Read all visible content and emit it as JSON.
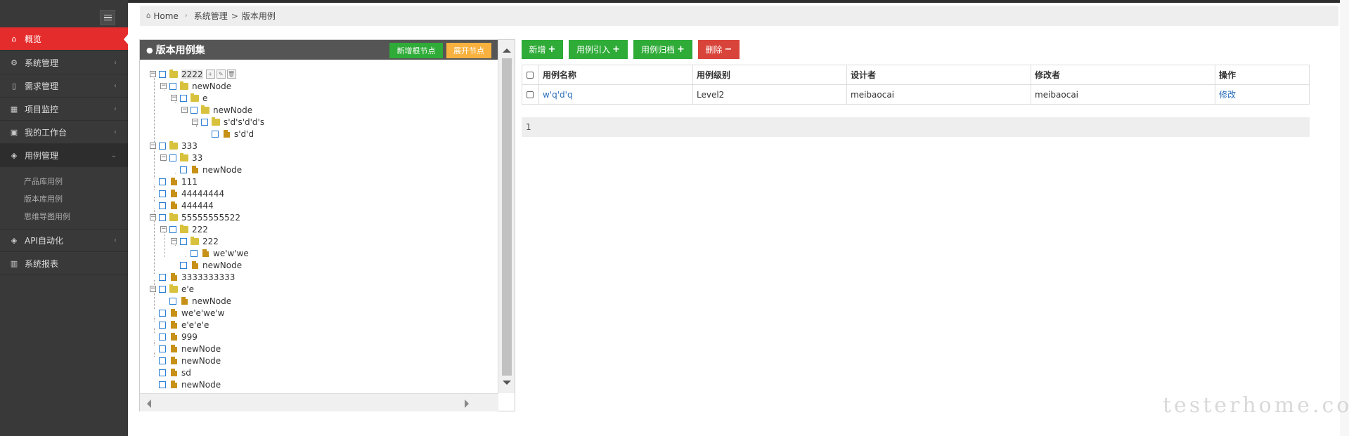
{
  "sidebar": {
    "items": [
      {
        "label": "概览",
        "icon": "home-icon"
      },
      {
        "label": "系统管理",
        "icon": "cogs-icon"
      },
      {
        "label": "需求管理",
        "icon": "bookmark-icon"
      },
      {
        "label": "项目监控",
        "icon": "table-icon"
      },
      {
        "label": "我的工作台",
        "icon": "briefcase-icon"
      },
      {
        "label": "用例管理",
        "icon": "gift-icon"
      },
      {
        "label": "API自动化",
        "icon": "gift-icon"
      },
      {
        "label": "系统报表",
        "icon": "bar-chart-icon"
      }
    ],
    "sub_items": [
      "产品库用例",
      "版本库用例",
      "思维导图用例"
    ]
  },
  "breadcrumb": {
    "home": "Home",
    "level1": "系统管理",
    "separator": ">",
    "level2": "版本用例"
  },
  "tree_panel": {
    "title": "版本用例集",
    "add_root_button": "新增根节点",
    "expand_button": "展开节点",
    "nodes": [
      "2222",
      "newNode",
      "e",
      "newNode",
      "s'd's'd'd's",
      "s'd'd",
      "333",
      "33",
      "newNode",
      "111",
      "44444444",
      "444444",
      "55555555522",
      "222",
      "222",
      "we'w'we",
      "newNode",
      "3333333333",
      "e'e",
      "newNode",
      "we'e'we'w",
      "e'e'e'e",
      "999",
      "newNode",
      "newNode",
      "sd",
      "newNode"
    ]
  },
  "toolbar": {
    "add": "新增",
    "import": "用例引入",
    "archive": "用例归档",
    "delete": "删除"
  },
  "table": {
    "headers": [
      "用例名称",
      "用例级别",
      "设计者",
      "修改者",
      "操作"
    ],
    "rows": [
      {
        "name": "w'q'd'q",
        "level": "Level2",
        "designer": "meibaocai",
        "modifier": "meibaocai",
        "action": "修改"
      }
    ]
  },
  "pager": {
    "page": "1"
  },
  "watermark": "testerhome.com",
  "colors": {
    "sidebar_bg": "#393939",
    "active_red": "#e52c2c",
    "green": "#2fab38",
    "orange": "#f8b13f",
    "red": "#d9443a",
    "link": "#2a6ebb"
  }
}
